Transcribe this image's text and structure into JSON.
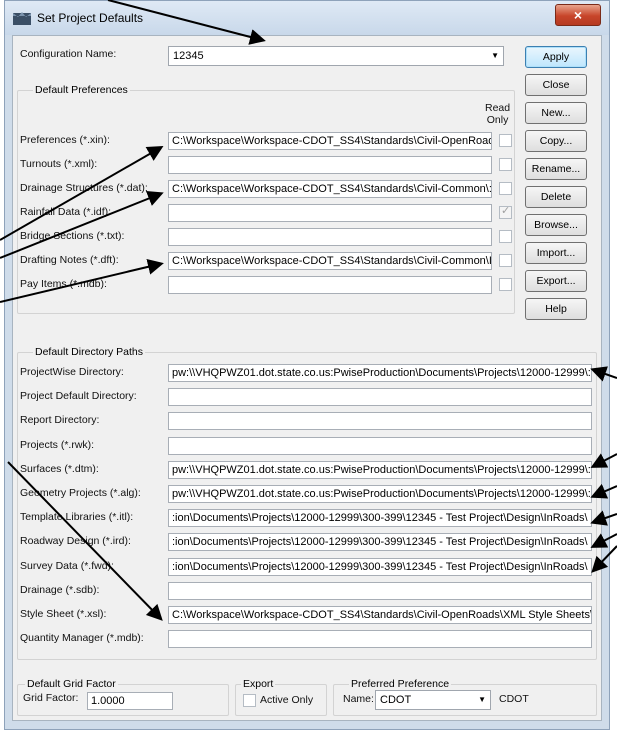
{
  "window": {
    "title": "Set Project Defaults",
    "close_glyph": "×"
  },
  "config": {
    "label": "Configuration Name:",
    "value": "12345"
  },
  "default_prefs": {
    "title": "Default Preferences",
    "read_only_header": [
      "Read",
      "Only"
    ],
    "rows": [
      {
        "label": "Preferences (*.xin):",
        "value": "C:\\Workspace\\Workspace-CDOT_SS4\\Standards\\Civil-OpenRoad",
        "checked": false
      },
      {
        "label": "Turnouts (*.xml):",
        "value": "",
        "checked": false
      },
      {
        "label": "Drainage Structures (*.dat):",
        "value": "C:\\Workspace\\Workspace-CDOT_SS4\\Standards\\Civil-Common\\:",
        "checked": false
      },
      {
        "label": "Rainfall Data (*.idf):",
        "value": "",
        "checked": true
      },
      {
        "label": "Bridge Sections (*.txt):",
        "value": "",
        "checked": false
      },
      {
        "label": "Drafting Notes (*.dft):",
        "value": "C:\\Workspace\\Workspace-CDOT_SS4\\Standards\\Civil-Common\\I",
        "checked": false
      },
      {
        "label": "Pay Items (*.mdb):",
        "value": "",
        "checked": false
      }
    ]
  },
  "buttons": {
    "apply": "Apply",
    "close": "Close",
    "new": "New...",
    "copy": "Copy...",
    "rename": "Rename...",
    "delete": "Delete",
    "browse": "Browse...",
    "import": "Import...",
    "export": "Export...",
    "help": "Help"
  },
  "dir_paths": {
    "title": "Default Directory Paths",
    "rows": [
      {
        "label": "ProjectWise Directory:",
        "value": "pw:\\\\VHQPWZ01.dot.state.co.us:PwiseProduction\\Documents\\Projects\\12000-12999\\:"
      },
      {
        "label": "Project Default Directory:",
        "value": ""
      },
      {
        "label": "Report Directory:",
        "value": ""
      },
      {
        "label": "Projects (*.rwk):",
        "value": ""
      },
      {
        "label": "Surfaces (*.dtm):",
        "value": "pw:\\\\VHQPWZ01.dot.state.co.us:PwiseProduction\\Documents\\Projects\\12000-12999\\:"
      },
      {
        "label": "Geometry Projects (*.alg):",
        "value": "pw:\\\\VHQPWZ01.dot.state.co.us:PwiseProduction\\Documents\\Projects\\12000-12999\\:"
      },
      {
        "label": "Template Libraries (*.itl):",
        "value": ":ion\\Documents\\Projects\\12000-12999\\300-399\\12345 - Test Project\\Design\\InRoads\\"
      },
      {
        "label": "Roadway Design (*.ird):",
        "value": ":ion\\Documents\\Projects\\12000-12999\\300-399\\12345 - Test Project\\Design\\InRoads\\"
      },
      {
        "label": "Survey Data (*.fwd):",
        "value": ":ion\\Documents\\Projects\\12000-12999\\300-399\\12345 - Test Project\\Design\\InRoads\\"
      },
      {
        "label": "Drainage (*.sdb):",
        "value": ""
      },
      {
        "label": "Style Sheet (*.xsl):",
        "value": "C:\\Workspace\\Workspace-CDOT_SS4\\Standards\\Civil-OpenRoads\\XML Style Sheets\\"
      },
      {
        "label": "Quantity Manager (*.mdb):",
        "value": ""
      }
    ]
  },
  "grid": {
    "title": "Default Grid Factor",
    "label": "Grid Factor:",
    "value": "1.0000"
  },
  "export_group": {
    "title": "Export",
    "checkbox_label": "Active Only",
    "checked": false
  },
  "preferred": {
    "title": "Preferred Preference",
    "name_label": "Name:",
    "value": "CDOT",
    "side_value": "CDOT"
  }
}
